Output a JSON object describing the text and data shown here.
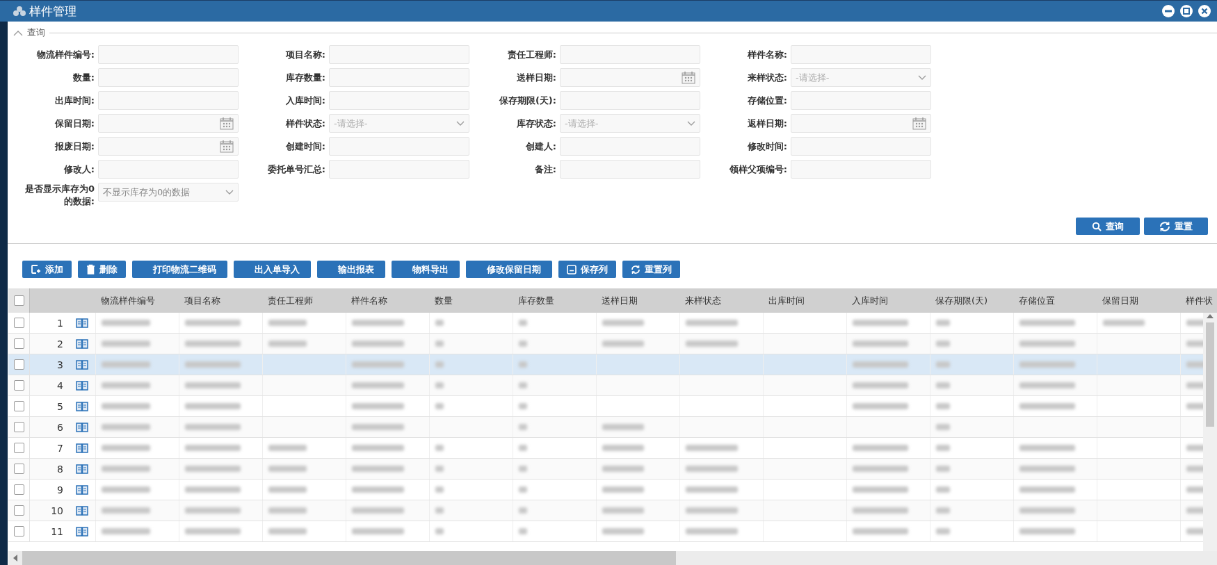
{
  "window": {
    "title": "样件管理"
  },
  "query": {
    "legend": "查询",
    "expanded": true,
    "fields": [
      {
        "label": "物流样件编号:",
        "kind": "text"
      },
      {
        "label": "项目名称:",
        "kind": "text"
      },
      {
        "label": "责任工程师:",
        "kind": "text"
      },
      {
        "label": "样件名称:",
        "kind": "text"
      },
      {
        "label": "数量:",
        "kind": "text"
      },
      {
        "label": "库存数量:",
        "kind": "text"
      },
      {
        "label": "送样日期:",
        "kind": "date"
      },
      {
        "label": "来样状态:",
        "kind": "select",
        "placeholder": "-请选择-"
      },
      {
        "label": "出库时间:",
        "kind": "text"
      },
      {
        "label": "入库时间:",
        "kind": "text"
      },
      {
        "label": "保存期限(天):",
        "kind": "text"
      },
      {
        "label": "存储位置:",
        "kind": "text"
      },
      {
        "label": "保留日期:",
        "kind": "date"
      },
      {
        "label": "样件状态:",
        "kind": "select",
        "placeholder": "-请选择-"
      },
      {
        "label": "库存状态:",
        "kind": "select",
        "placeholder": "-请选择-"
      },
      {
        "label": "返样日期:",
        "kind": "date"
      },
      {
        "label": "报废日期:",
        "kind": "date"
      },
      {
        "label": "创建时间:",
        "kind": "text"
      },
      {
        "label": "创建人:",
        "kind": "text"
      },
      {
        "label": "修改时间:",
        "kind": "text"
      },
      {
        "label": "修改人:",
        "kind": "text"
      },
      {
        "label": "委托单号汇总:",
        "kind": "text"
      },
      {
        "label": "备注:",
        "kind": "text"
      },
      {
        "label": "领样父项编号:",
        "kind": "text"
      },
      {
        "label": "是否显示库存为0的数据:",
        "kind": "select",
        "value": "不显示库存为0的数据"
      }
    ],
    "buttons": [
      {
        "label": "查询",
        "kind": "search"
      },
      {
        "label": "重置",
        "kind": "reset"
      }
    ]
  },
  "toolbar": [
    {
      "label": "添加",
      "kind": "add"
    },
    {
      "label": "删除",
      "kind": "delete"
    },
    {
      "label": "打印物流二维码",
      "kind": "none"
    },
    {
      "label": "出入单导入",
      "kind": "none"
    },
    {
      "label": "输出报表",
      "kind": "none"
    },
    {
      "label": "物料导出",
      "kind": "none"
    },
    {
      "label": "修改保留日期",
      "kind": "none"
    },
    {
      "label": "保存列",
      "kind": "save"
    },
    {
      "label": "重置列",
      "kind": "refresh"
    }
  ],
  "table": {
    "select_all": {
      "checked": false
    },
    "columns": [
      "物流样件编号",
      "项目名称",
      "责任工程师",
      "样件名称",
      "数量",
      "库存数量",
      "送样日期",
      "来样状态",
      "出库时间",
      "入库时间",
      "保存期限(天)",
      "存储位置",
      "保留日期",
      "样件状"
    ],
    "rows": [
      {
        "number": "1",
        "checked": false,
        "highlighted": false,
        "redacted_cells": [
          true,
          true,
          true,
          true,
          true,
          true,
          true,
          true,
          false,
          true,
          true,
          true,
          true,
          true
        ]
      },
      {
        "number": "2",
        "checked": false,
        "highlighted": false,
        "redacted_cells": [
          true,
          true,
          true,
          true,
          true,
          true,
          true,
          true,
          false,
          true,
          true,
          true,
          false,
          true
        ]
      },
      {
        "number": "3",
        "checked": false,
        "highlighted": true,
        "redacted_cells": [
          true,
          true,
          false,
          true,
          true,
          true,
          false,
          false,
          false,
          true,
          true,
          true,
          false,
          true
        ]
      },
      {
        "number": "4",
        "checked": false,
        "highlighted": false,
        "redacted_cells": [
          true,
          true,
          false,
          true,
          true,
          true,
          false,
          false,
          false,
          true,
          true,
          true,
          false,
          true
        ]
      },
      {
        "number": "5",
        "checked": false,
        "highlighted": false,
        "redacted_cells": [
          true,
          true,
          false,
          true,
          true,
          true,
          false,
          false,
          false,
          true,
          true,
          true,
          false,
          true
        ]
      },
      {
        "number": "6",
        "checked": false,
        "highlighted": false,
        "redacted_cells": [
          true,
          true,
          false,
          true,
          false,
          true,
          true,
          false,
          false,
          false,
          true,
          false,
          false,
          false
        ]
      },
      {
        "number": "7",
        "checked": false,
        "highlighted": false,
        "redacted_cells": [
          true,
          true,
          true,
          true,
          true,
          true,
          true,
          true,
          false,
          true,
          true,
          true,
          false,
          true
        ]
      },
      {
        "number": "8",
        "checked": false,
        "highlighted": false,
        "redacted_cells": [
          true,
          true,
          true,
          true,
          true,
          true,
          true,
          true,
          false,
          true,
          true,
          true,
          false,
          true
        ]
      },
      {
        "number": "9",
        "checked": false,
        "highlighted": false,
        "redacted_cells": [
          true,
          true,
          true,
          true,
          true,
          true,
          true,
          true,
          false,
          true,
          true,
          true,
          false,
          true
        ]
      },
      {
        "number": "10",
        "checked": false,
        "highlighted": false,
        "redacted_cells": [
          true,
          true,
          true,
          true,
          true,
          true,
          true,
          true,
          false,
          true,
          true,
          true,
          false,
          true
        ]
      },
      {
        "number": "11",
        "checked": false,
        "highlighted": false,
        "redacted_cells": [
          true,
          true,
          true,
          true,
          true,
          true,
          true,
          true,
          false,
          true,
          true,
          true,
          false,
          true
        ]
      }
    ]
  }
}
